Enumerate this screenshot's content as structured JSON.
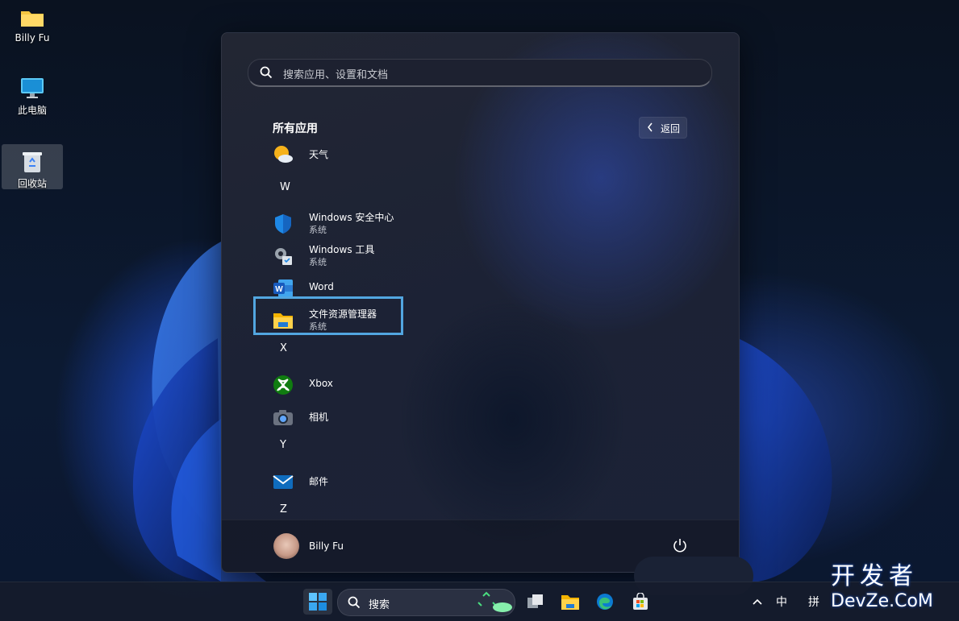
{
  "desktop": {
    "icons": [
      {
        "label": "Billy Fu",
        "icon": "folder-icon"
      },
      {
        "label": "此电脑",
        "icon": "computer-icon"
      },
      {
        "label": "回收站",
        "icon": "recycle-bin-icon"
      }
    ]
  },
  "start_menu": {
    "search_placeholder": "搜索应用、设置和文档",
    "section_title": "所有应用",
    "back_label": "返回",
    "apps": [
      {
        "name": "天气",
        "sub": "",
        "icon": "weather-icon"
      },
      {
        "letter": "W"
      },
      {
        "name": "Windows 安全中心",
        "sub": "系统",
        "icon": "shield-icon"
      },
      {
        "name": "Windows 工具",
        "sub": "系统",
        "icon": "tools-gear-icon"
      },
      {
        "name": "Word",
        "sub": "",
        "icon": "word-icon"
      },
      {
        "name": "文件资源管理器",
        "sub": "系统",
        "icon": "file-explorer-icon",
        "highlighted": true
      },
      {
        "letter": "X"
      },
      {
        "name": "Xbox",
        "sub": "",
        "icon": "xbox-icon"
      },
      {
        "name": "相机",
        "sub": "",
        "icon": "camera-icon"
      },
      {
        "letter": "Y"
      },
      {
        "name": "邮件",
        "sub": "",
        "icon": "mail-icon"
      },
      {
        "letter": "Z"
      }
    ],
    "user_name": "Billy Fu"
  },
  "taskbar": {
    "search_label": "搜索",
    "tray": {
      "ime_mode": "中",
      "ime_name": "拼"
    }
  },
  "watermark": {
    "line1": "开发者",
    "line2": "DevZe.CoM"
  },
  "colors": {
    "accent": "#52a6e0",
    "desktop_bg": "#0c1a32"
  }
}
